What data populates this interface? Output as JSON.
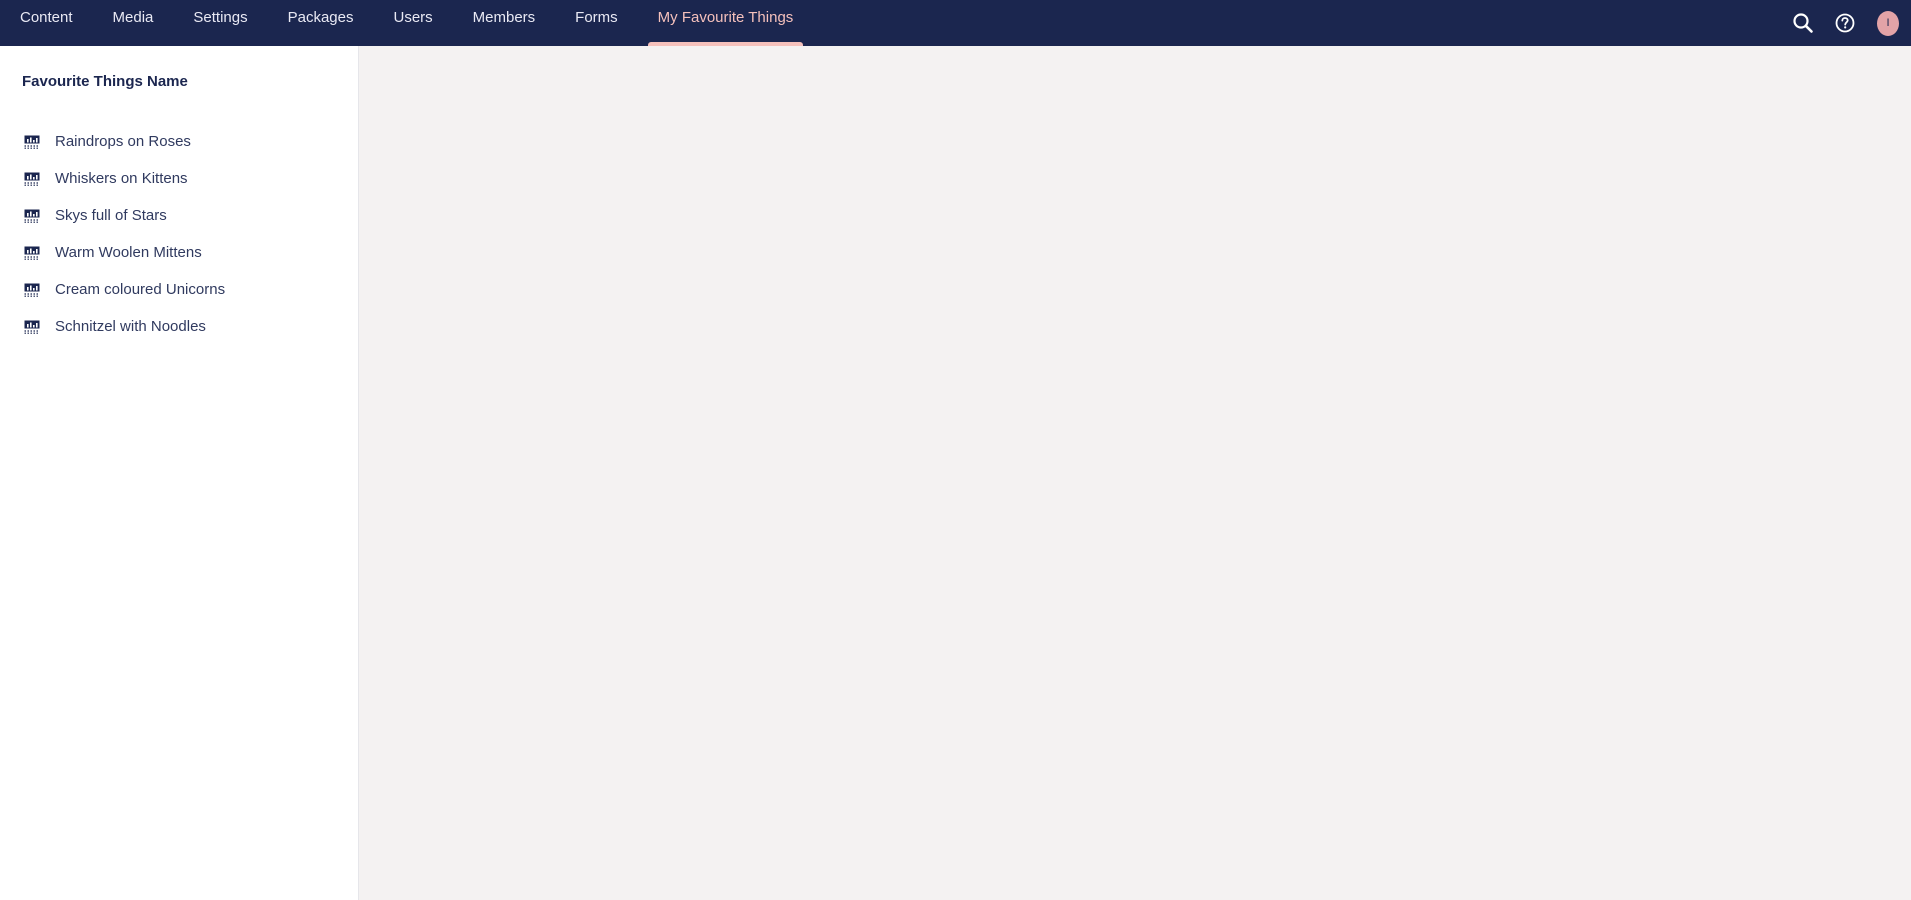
{
  "nav": {
    "items": [
      {
        "label": "Content"
      },
      {
        "label": "Media"
      },
      {
        "label": "Settings"
      },
      {
        "label": "Packages"
      },
      {
        "label": "Users"
      },
      {
        "label": "Members"
      },
      {
        "label": "Forms"
      },
      {
        "label": "My Favourite Things",
        "active": true
      }
    ]
  },
  "tools": {
    "search_icon": "search-icon",
    "help_icon": "help-icon",
    "avatar_initial": "I"
  },
  "tree": {
    "root_label": "Favourite Things Name",
    "item_icon": "chart-icon",
    "items": [
      {
        "label": "Raindrops on Roses"
      },
      {
        "label": "Whiskers on Kittens"
      },
      {
        "label": "Skys full of Stars"
      },
      {
        "label": "Warm Woolen Mittens"
      },
      {
        "label": "Cream coloured Unicorns"
      },
      {
        "label": "Schnitzel with Noodles"
      }
    ]
  },
  "colors": {
    "topbar": "#1b264f",
    "active_accent": "#f5c1bc",
    "avatar_bg": "#e3a3a7",
    "main_bg": "#f4f2f2"
  }
}
